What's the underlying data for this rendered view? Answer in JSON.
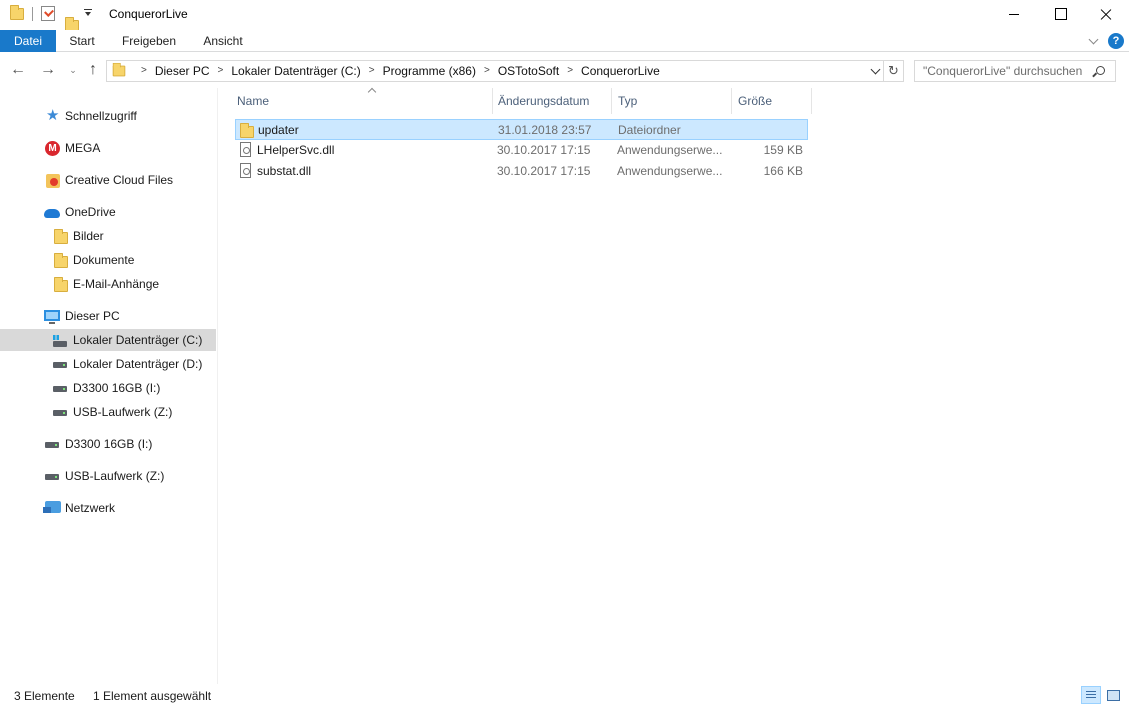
{
  "window": {
    "title": "ConquerorLive"
  },
  "ribbon": {
    "tabs": [
      "Datei",
      "Start",
      "Freigeben",
      "Ansicht"
    ]
  },
  "address": {
    "crumbs": [
      "Dieser PC",
      "Lokaler Datenträger (C:)",
      "Programme (x86)",
      "OSTotoSoft",
      "ConquerorLive"
    ]
  },
  "search": {
    "placeholder": "\"ConquerorLive\" durchsuchen"
  },
  "nav": {
    "items": [
      {
        "label": "Schnellzugriff",
        "icon": "star-icon"
      },
      {
        "label": "MEGA",
        "icon": "mega-icon"
      },
      {
        "label": "Creative Cloud Files",
        "icon": "creative-cloud-icon"
      },
      {
        "label": "OneDrive",
        "icon": "cloud-icon"
      },
      {
        "label": "Bilder",
        "icon": "folder-icon"
      },
      {
        "label": "Dokumente",
        "icon": "folder-icon"
      },
      {
        "label": "E-Mail-Anhänge",
        "icon": "folder-icon"
      },
      {
        "label": "Dieser PC",
        "icon": "computer-icon"
      },
      {
        "label": "Lokaler Datenträger (C:)",
        "icon": "system-drive-icon"
      },
      {
        "label": "Lokaler Datenträger (D:)",
        "icon": "drive-icon"
      },
      {
        "label": "D3300 16GB (I:)",
        "icon": "drive-icon"
      },
      {
        "label": "USB-Laufwerk (Z:)",
        "icon": "drive-icon"
      },
      {
        "label": "D3300 16GB (I:)",
        "icon": "drive-icon"
      },
      {
        "label": "USB-Laufwerk (Z:)",
        "icon": "drive-icon"
      },
      {
        "label": "Netzwerk",
        "icon": "network-icon"
      }
    ]
  },
  "columns": [
    "Name",
    "Änderungsdatum",
    "Typ",
    "Größe"
  ],
  "files": [
    {
      "name": "updater",
      "date": "31.01.2018 23:57",
      "type": "Dateiordner",
      "size": "",
      "icon": "folder-icon"
    },
    {
      "name": "LHelperSvc.dll",
      "date": "30.10.2017 17:15",
      "type": "Anwendungserwe...",
      "size": "159 KB",
      "icon": "dll-file-icon"
    },
    {
      "name": "substat.dll",
      "date": "30.10.2017 17:15",
      "type": "Anwendungserwe...",
      "size": "166 KB",
      "icon": "dll-file-icon"
    }
  ],
  "status": {
    "count": "3 Elemente",
    "selection": "1 Element ausgewählt"
  },
  "colors": {
    "accent": "#1979ca",
    "selection": "#cce8ff",
    "nav_selection": "#d9d9d9"
  }
}
